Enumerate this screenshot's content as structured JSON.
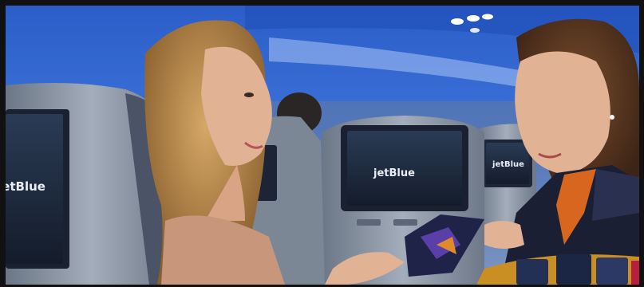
{
  "scene": {
    "description_hidden": "",
    "screens": [
      {
        "id": "left-seatback-screen",
        "logo": "jetBlue"
      },
      {
        "id": "center-seatback-screen",
        "logo": "jetBlue"
      },
      {
        "id": "right-seatback-screen",
        "logo": "jetBlue"
      }
    ],
    "colors": {
      "cabin_blue": "#2f5fc9",
      "cabin_light": "#6f9bf0",
      "seat_gray": "#8d98a8",
      "screen_dark": "#1e2a3b",
      "hair_blonde": "#b9894f",
      "skin": "#e2b295",
      "scarf_orange": "#d9661f",
      "uniform_navy": "#1a1f33"
    }
  }
}
